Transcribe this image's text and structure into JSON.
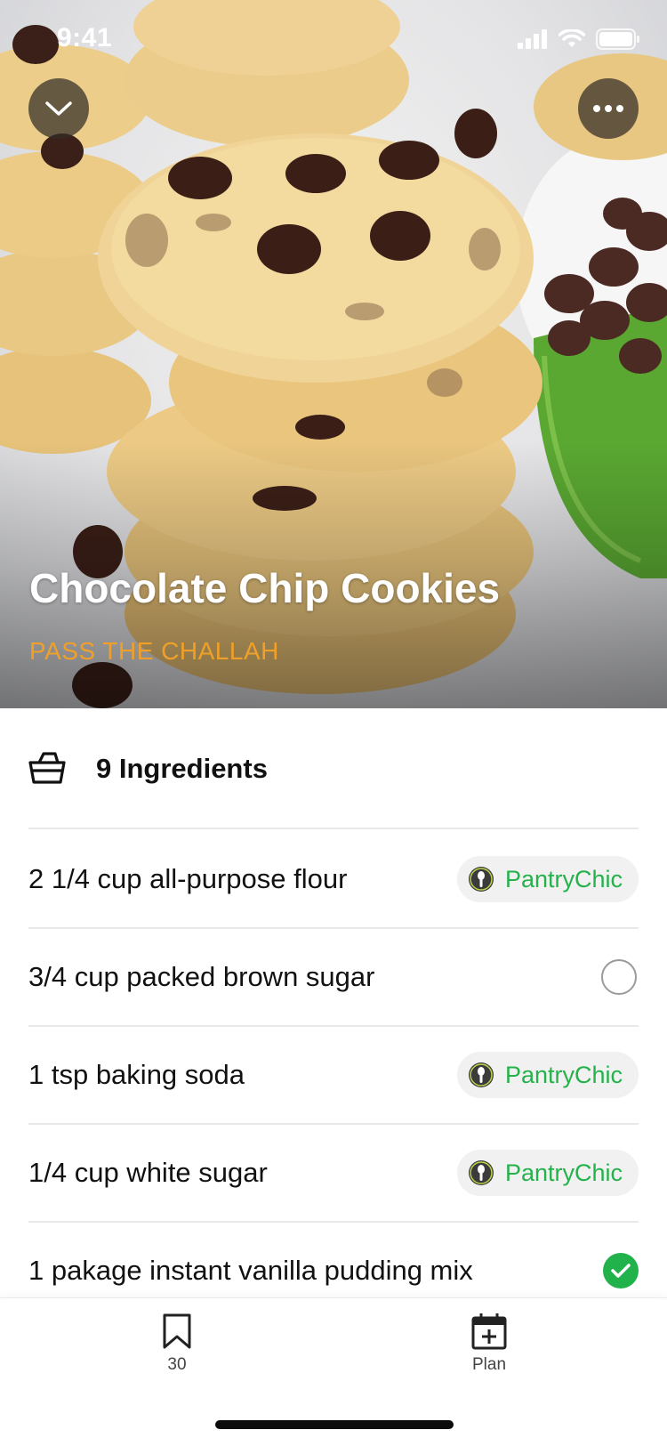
{
  "status_bar": {
    "time": "9:41"
  },
  "hero": {
    "title": "Chocolate Chip Cookies",
    "source": "PASS THE CHALLAH"
  },
  "ingredients": {
    "count_label": "9 Ingredients",
    "items": [
      {
        "text": "2 1/4 cup all-purpose flour",
        "status": "pantry",
        "pantry_label": "PantryChic"
      },
      {
        "text": "3/4 cup packed brown sugar",
        "status": "unchecked"
      },
      {
        "text": "1 tsp baking soda",
        "status": "pantry",
        "pantry_label": "PantryChic"
      },
      {
        "text": "1/4 cup white sugar",
        "status": "pantry",
        "pantry_label": "PantryChic"
      },
      {
        "text": "1 pakage instant vanilla pudding mix",
        "status": "checked"
      }
    ]
  },
  "tabbar": {
    "saved_label": "30",
    "plan_label": "Plan"
  },
  "colors": {
    "accent_green": "#25b24b",
    "source_orange": "#f0a028"
  }
}
